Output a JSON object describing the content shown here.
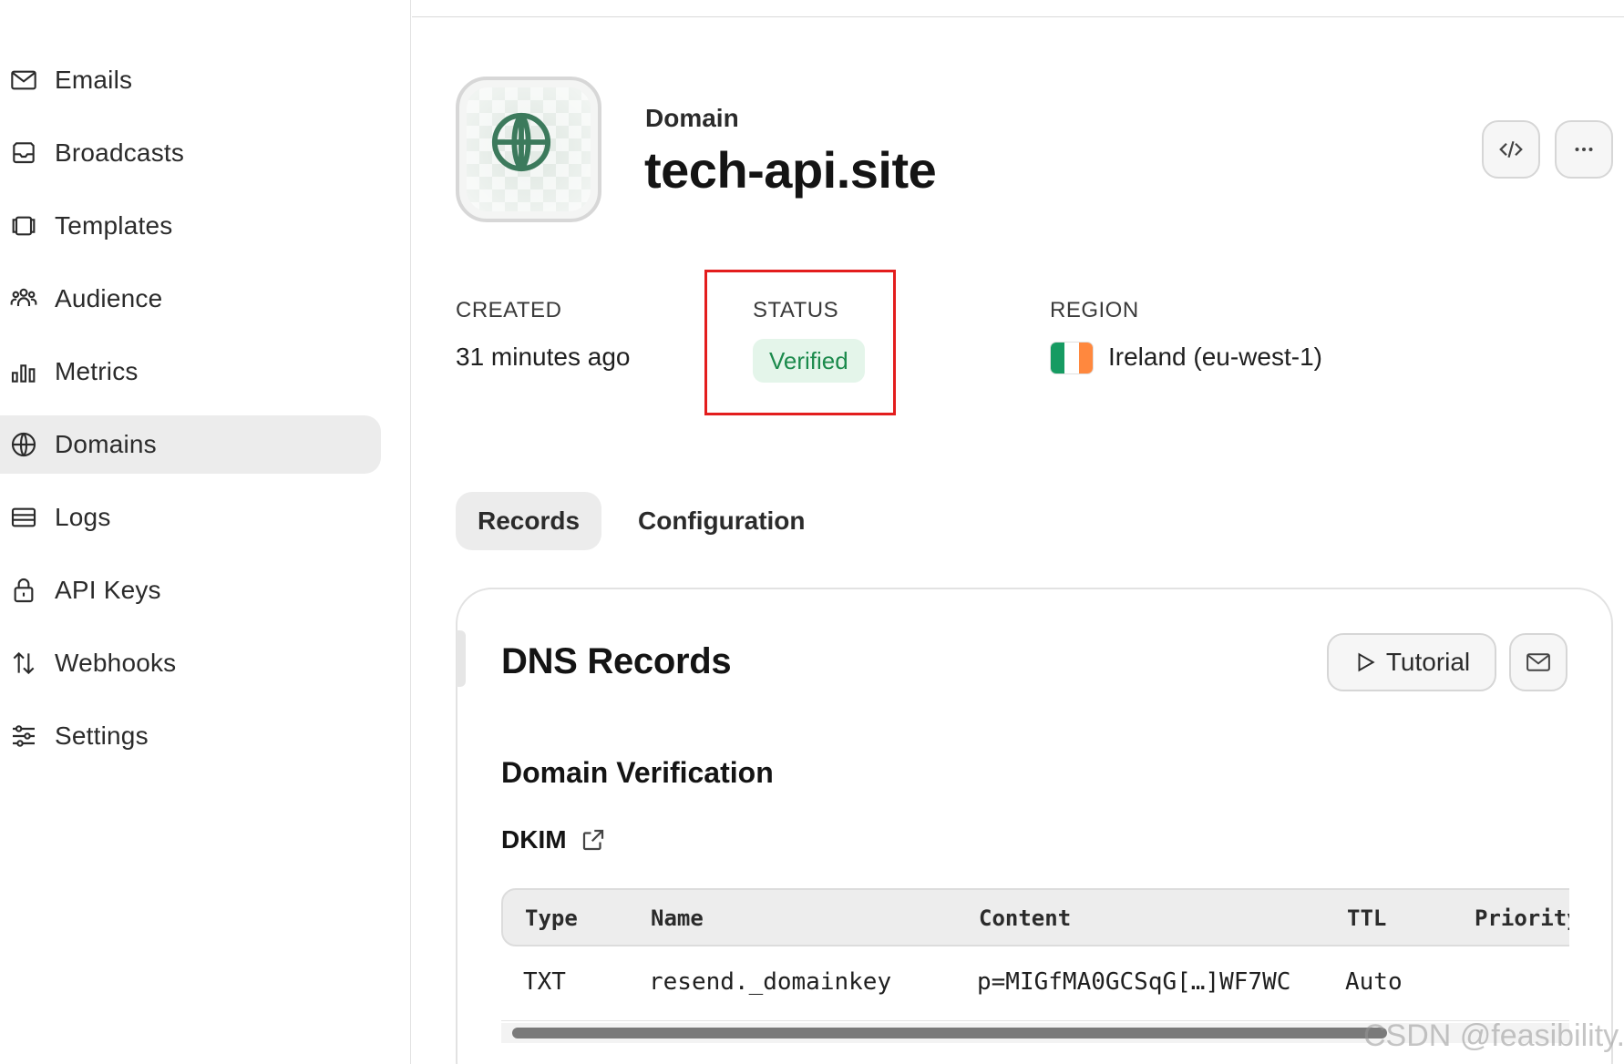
{
  "sidebar": {
    "items": [
      {
        "label": "Emails",
        "icon": "mail-icon"
      },
      {
        "label": "Broadcasts",
        "icon": "inbox-icon"
      },
      {
        "label": "Templates",
        "icon": "templates-icon"
      },
      {
        "label": "Audience",
        "icon": "users-icon"
      },
      {
        "label": "Metrics",
        "icon": "bar-chart-icon"
      },
      {
        "label": "Domains",
        "icon": "globe-icon",
        "active": true
      },
      {
        "label": "Logs",
        "icon": "logs-icon"
      },
      {
        "label": "API Keys",
        "icon": "lock-icon"
      },
      {
        "label": "Webhooks",
        "icon": "arrows-up-down-icon"
      },
      {
        "label": "Settings",
        "icon": "sliders-icon"
      }
    ]
  },
  "header": {
    "eyebrow": "Domain",
    "domain": "tech-api.site",
    "tile_icon": "globe-icon",
    "actions": {
      "code_icon": "code-icon",
      "more_icon": "more-horizontal-icon",
      "more_glyph": "···"
    }
  },
  "meta": {
    "created_label": "CREATED",
    "created_value": "31 minutes ago",
    "status_label": "STATUS",
    "status_value": "Verified",
    "region_label": "REGION",
    "region_value": "Ireland (eu-west-1)",
    "flag_colors": [
      "#169b62",
      "#ffffff",
      "#ff883e"
    ]
  },
  "tabs": [
    {
      "label": "Records",
      "active": true
    },
    {
      "label": "Configuration",
      "active": false
    }
  ],
  "dns": {
    "title": "DNS Records",
    "tutorial_label": "Tutorial",
    "section_title": "Domain Verification",
    "dkim_label": "DKIM",
    "table": {
      "headers": [
        "Type",
        "Name",
        "Content",
        "TTL",
        "Priority"
      ],
      "rows": [
        [
          "TXT",
          "resend._domainkey",
          "p=MIGfMA0GCSqG[…]WF7WC",
          "Auto",
          ""
        ]
      ]
    }
  },
  "watermark": "CSDN @feasibility.",
  "colors": {
    "accent_green": "#1b8a4c",
    "badge_bg": "#e4f5ea",
    "highlight_red": "#e31d1d",
    "globe_green": "#3c7a5c"
  }
}
